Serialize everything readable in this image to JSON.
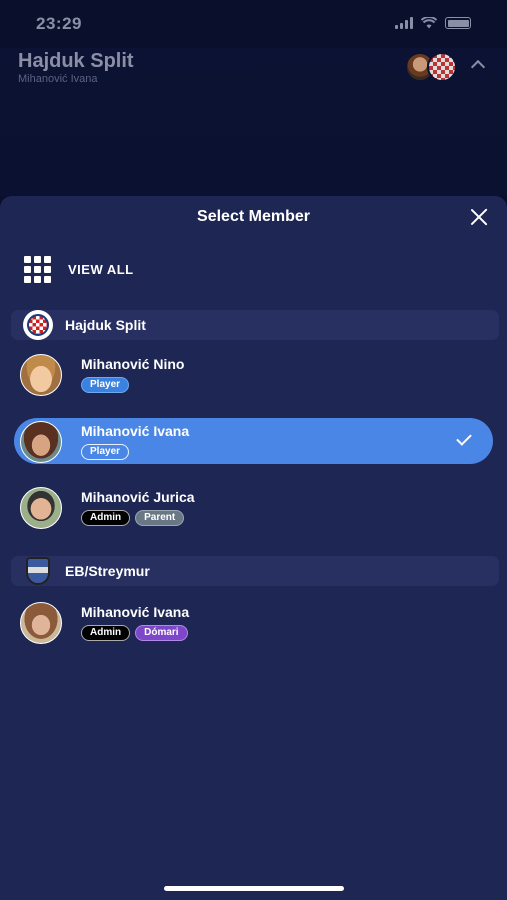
{
  "status_bar": {
    "time": "23:29"
  },
  "header": {
    "title": "Hajduk Split",
    "subtitle": "Mihanović Ivana"
  },
  "sheet": {
    "title": "Select Member",
    "view_all_label": "VIEW ALL"
  },
  "groups": [
    {
      "name": "Hajduk Split",
      "icon": "hajduk-crest-icon",
      "members": [
        {
          "name": "Mihanović Nino",
          "badges": [
            "Player"
          ],
          "selected": false
        },
        {
          "name": "Mihanović Ivana",
          "badges": [
            "Player"
          ],
          "selected": true
        },
        {
          "name": "Mihanović Jurica",
          "badges": [
            "Admin",
            "Parent"
          ],
          "selected": false
        }
      ]
    },
    {
      "name": "EB/Streymur",
      "icon": "streymur-shield-icon",
      "members": [
        {
          "name": "Mihanović Ivana",
          "badges": [
            "Admin",
            "Dómari"
          ],
          "selected": false
        }
      ]
    }
  ],
  "colors": {
    "background": "#0a0f2b",
    "sheet": "#1e2654",
    "group_header": "#283062",
    "selected_row": "#4a86e6",
    "player_badge": "#3a82e0",
    "admin_badge": "#000000",
    "parent_badge": "#6a7886",
    "domari_badge": "#7e46c8"
  }
}
